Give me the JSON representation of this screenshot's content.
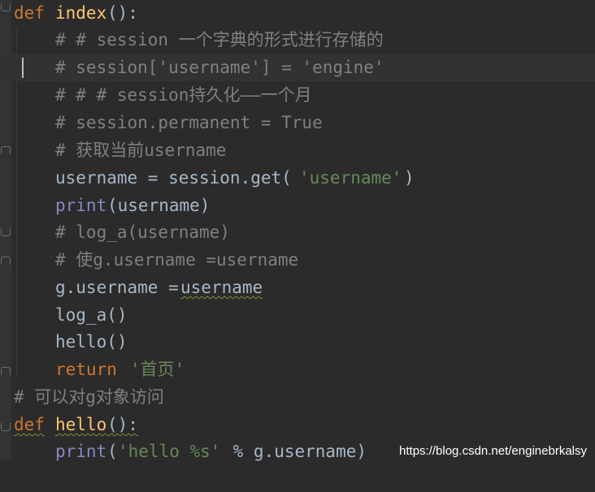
{
  "editor": {
    "lines": [
      [
        "def",
        " ",
        "index",
        "():"
      ],
      [
        "# # session 一个字典的形式进行存储的"
      ],
      [
        "# session['username'] = 'engine'"
      ],
      [
        "# # # session持久化——一个月"
      ],
      [
        "# session.permanent = True"
      ],
      [
        "# 获取当前username"
      ],
      [
        "username = session.get(",
        "'username'",
        ")"
      ],
      [
        "print",
        "(username)"
      ],
      [
        "# log_a(username)"
      ],
      [
        "# 使g.username =username"
      ],
      [
        "g.username =",
        "username"
      ],
      [
        "log_a()"
      ],
      [
        "hello()"
      ],
      [
        "return",
        " ",
        "'首页'"
      ],
      [
        "# 可以对g对象访问"
      ],
      [
        "def",
        " ",
        "hello",
        "():"
      ],
      [
        "print",
        "(",
        "'hello %s'",
        " % g.username)"
      ]
    ]
  },
  "watermark": "https://blog.csdn.net/enginebrkalsy"
}
